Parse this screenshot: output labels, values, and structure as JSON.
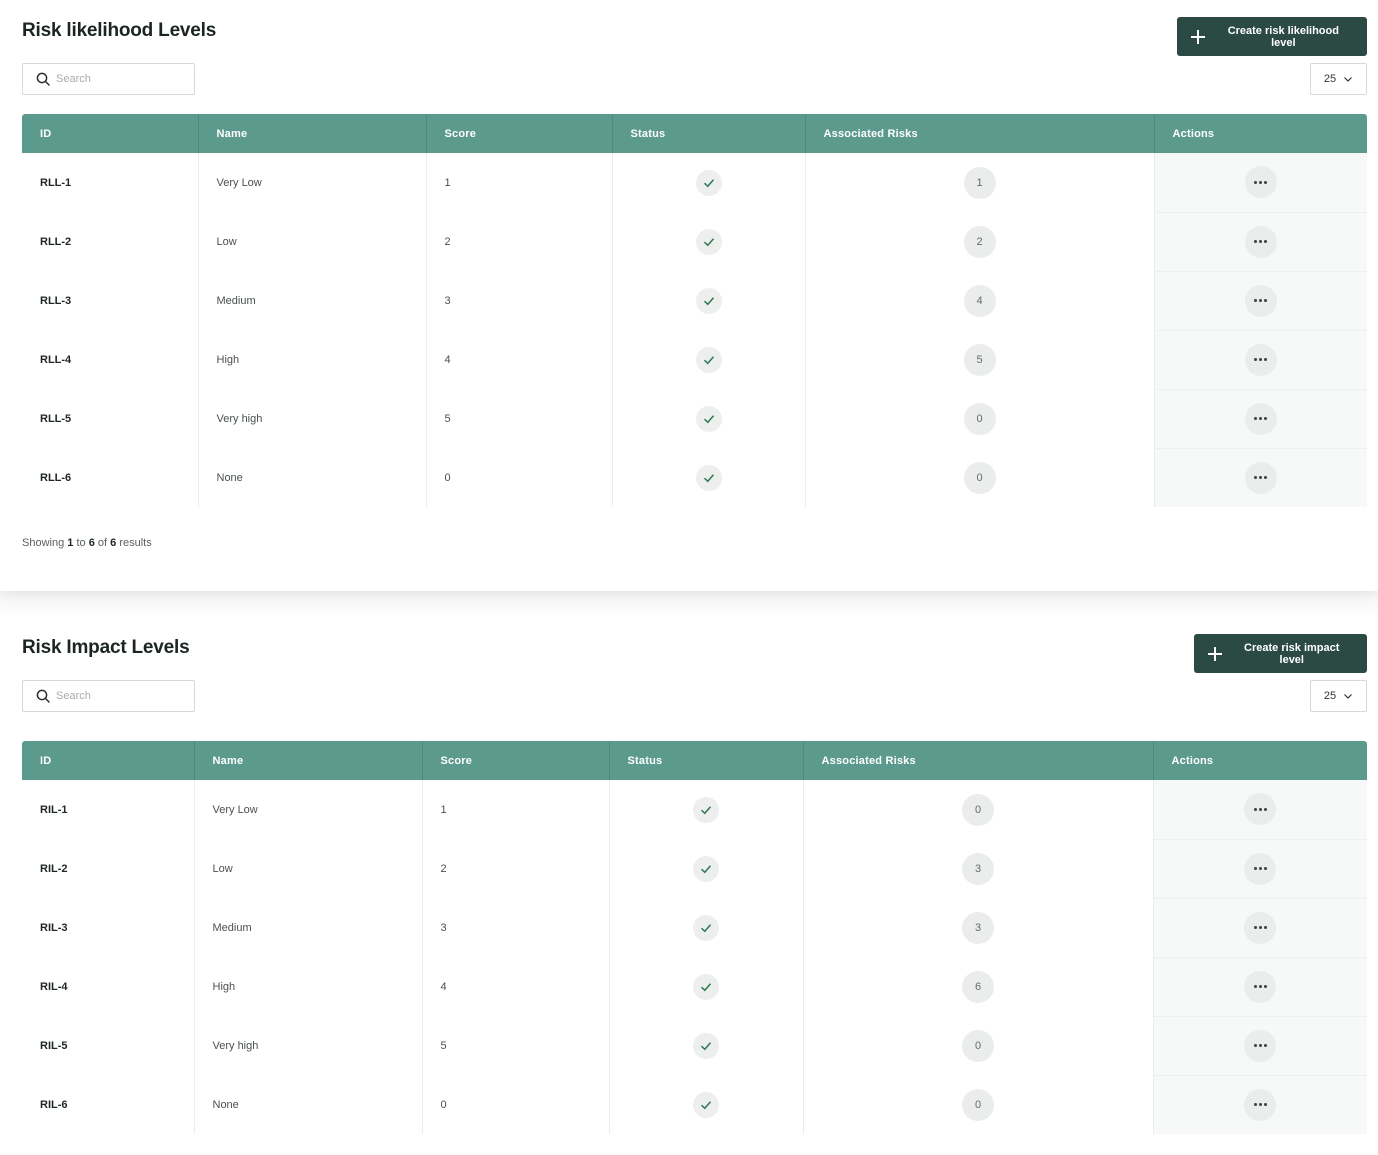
{
  "likelihood": {
    "title": "Risk likelihood Levels",
    "create_label": "Create risk likelihood level",
    "search_placeholder": "Search",
    "per_page": "25",
    "columns": [
      "ID",
      "Name",
      "Score",
      "Status",
      "Associated Risks",
      "Actions"
    ],
    "rows": [
      {
        "id": "RLL-1",
        "name": "Very Low",
        "score": "1",
        "risks": "1"
      },
      {
        "id": "RLL-2",
        "name": "Low",
        "score": "2",
        "risks": "2"
      },
      {
        "id": "RLL-3",
        "name": "Medium",
        "score": "3",
        "risks": "4"
      },
      {
        "id": "RLL-4",
        "name": "High",
        "score": "4",
        "risks": "5"
      },
      {
        "id": "RLL-5",
        "name": "Very high",
        "score": "5",
        "risks": "0"
      },
      {
        "id": "RLL-6",
        "name": "None",
        "score": "0",
        "risks": "0"
      }
    ],
    "showing": {
      "prefix": "Showing",
      "from": "1",
      "to_word": "to",
      "to": "6",
      "of_word": "of",
      "total": "6",
      "suffix": "results"
    }
  },
  "impact": {
    "title": "Risk Impact Levels",
    "create_label": "Create risk impact level",
    "search_placeholder": "Search",
    "per_page": "25",
    "columns": [
      "ID",
      "Name",
      "Score",
      "Status",
      "Associated Risks",
      "Actions"
    ],
    "rows": [
      {
        "id": "RIL-1",
        "name": "Very Low",
        "score": "1",
        "risks": "0"
      },
      {
        "id": "RIL-2",
        "name": "Low",
        "score": "2",
        "risks": "3"
      },
      {
        "id": "RIL-3",
        "name": "Medium",
        "score": "3",
        "risks": "3"
      },
      {
        "id": "RIL-4",
        "name": "High",
        "score": "4",
        "risks": "6"
      },
      {
        "id": "RIL-5",
        "name": "Very high",
        "score": "5",
        "risks": "0"
      },
      {
        "id": "RIL-6",
        "name": "None",
        "score": "0",
        "risks": "0"
      }
    ]
  },
  "icons": {
    "search": "search-icon",
    "status_active": "check-icon",
    "actions": "more-horizontal-icon",
    "per_page_toggle": "chevron-down-icon",
    "create": "plus-icon"
  },
  "colors": {
    "header_bg": "#5b9a8c",
    "button_bg": "#2b4a44",
    "check": "#2f7a52"
  }
}
